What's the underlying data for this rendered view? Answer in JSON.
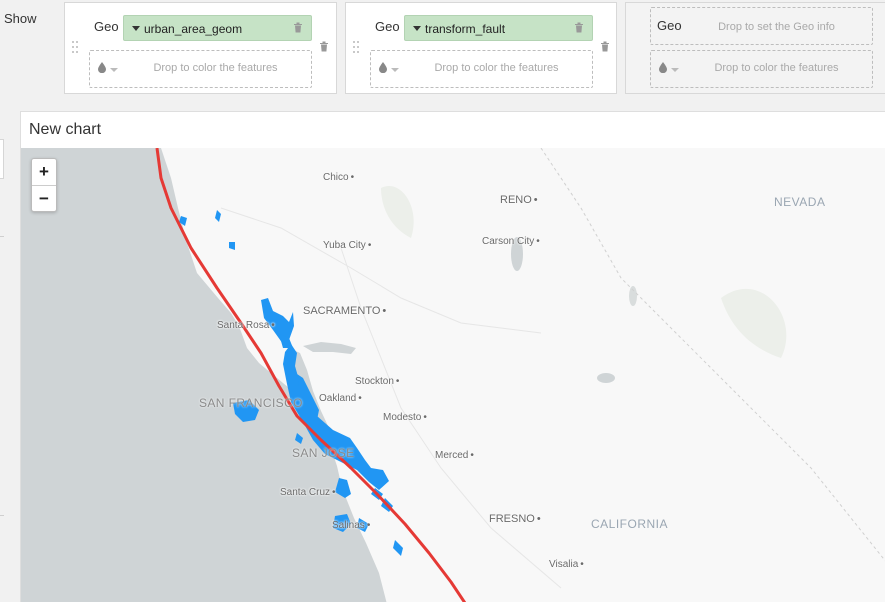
{
  "show_label": "Show",
  "layers": [
    {
      "geo_label": "Geo",
      "geo_value": "urban_area_geom",
      "color_drop_text": "Drop to color the features"
    },
    {
      "geo_label": "Geo",
      "geo_value": "transform_fault",
      "color_drop_text": "Drop to color the features"
    },
    {
      "geo_label": "Geo",
      "geo_drop_text": "Drop to set the Geo info",
      "color_drop_text": "Drop to color the features"
    }
  ],
  "chart": {
    "title": "New chart",
    "zoom_in": "+",
    "zoom_out": "−",
    "colors": {
      "urban_area": "#2196f3",
      "fault": "#e53935",
      "water": "#cfd4d6",
      "land": "#f7f7f7"
    },
    "cities": [
      {
        "name": "Chico"
      },
      {
        "name": "RENO"
      },
      {
        "name": "Yuba City"
      },
      {
        "name": "Carson City"
      },
      {
        "name": "SACRAMENTO"
      },
      {
        "name": "Santa Rosa"
      },
      {
        "name": "Stockton"
      },
      {
        "name": "Oakland"
      },
      {
        "name": "Modesto"
      },
      {
        "name": "Merced"
      },
      {
        "name": "Santa Cruz"
      },
      {
        "name": "Salinas"
      },
      {
        "name": "FRESNO"
      },
      {
        "name": "Visalia"
      }
    ],
    "metros": [
      "SAN FRANCISCO",
      "SAN JOSE"
    ],
    "regions": [
      "NEVADA",
      "CALIFORNIA"
    ]
  }
}
